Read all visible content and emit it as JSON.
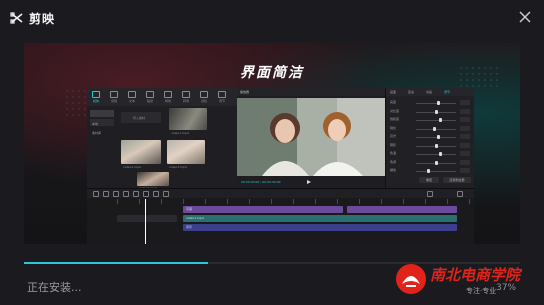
{
  "app": {
    "name": "剪映",
    "logo_icon": "capcut-logo-icon",
    "close_icon": "close-icon"
  },
  "banner": {
    "title": "界面简洁",
    "editor": {
      "toolbar": [
        {
          "label": "媒体",
          "active": true
        },
        {
          "label": "音频"
        },
        {
          "label": "文本"
        },
        {
          "label": "贴纸"
        },
        {
          "label": "特效"
        },
        {
          "label": "转场"
        },
        {
          "label": "滤镜"
        },
        {
          "label": "调节"
        }
      ],
      "media_nav": [
        "本地",
        "素材库"
      ],
      "media_items": [
        {
          "caption": "导入素材"
        },
        {
          "caption": "video1.mp4"
        },
        {
          "caption": "video2.mp4"
        },
        {
          "caption": "video3.mp4"
        },
        {
          "caption": "video4.mp4"
        }
      ],
      "player": {
        "title": "播放器",
        "time": "00:00:00:00 / 00:00:30:00"
      },
      "props": {
        "tabs": [
          "画面",
          "变速",
          "动画",
          "调节"
        ],
        "active_tab": "调节",
        "rows": [
          {
            "label": "亮度",
            "level": 0.55
          },
          {
            "label": "对比度",
            "level": 0.5
          },
          {
            "label": "饱和度",
            "level": 0.62
          },
          {
            "label": "锐化",
            "level": 0.45
          },
          {
            "label": "高光",
            "level": 0.55
          },
          {
            "label": "阴影",
            "level": 0.5
          },
          {
            "label": "色温",
            "level": 0.6
          },
          {
            "label": "色调",
            "level": 0.5
          },
          {
            "label": "褪色",
            "level": 0.3
          }
        ],
        "buttons": [
          "重置",
          "应用到全部"
        ]
      },
      "timeline": {
        "tracks": [
          {
            "label": "字幕",
            "color": "#7b4fb0"
          },
          {
            "label": "video1.mp4",
            "color": "#2b6f73"
          },
          {
            "label": "音乐",
            "color": "#3b3f8c"
          }
        ]
      }
    }
  },
  "install": {
    "status_text": "正在安装...",
    "percent_text": "37%",
    "progress": 0.37,
    "accent_color": "#2cc9d5"
  },
  "watermark": {
    "name": "南北电商学院",
    "subtitle": "专注·专业"
  }
}
